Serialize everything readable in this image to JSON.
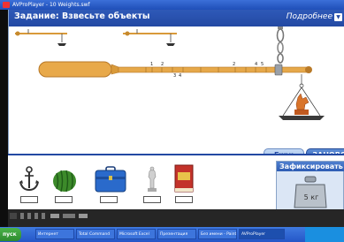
{
  "window": {
    "title": "AVProPlayer - 10 Weights.swf"
  },
  "header": {
    "task_title": "Задание: Взвесьте объекты",
    "more_label": "Подробнее",
    "more_arrow": "▼"
  },
  "scale": {
    "tick_labels": [
      "1",
      "2",
      "3",
      "4",
      "2",
      "4",
      "5"
    ]
  },
  "tabs": {
    "weights": "Гири",
    "reset": "ЗАНОВО"
  },
  "objects": [
    {
      "name": "anchor",
      "label": ""
    },
    {
      "name": "watermelon",
      "label": ""
    },
    {
      "name": "briefcase",
      "label": ""
    },
    {
      "name": "statuette",
      "label": ""
    },
    {
      "name": "book",
      "label": ""
    }
  ],
  "fix_panel": {
    "title": "Зафиксировать",
    "weight_label": "5 кг"
  },
  "taskbar": {
    "start": "пуск",
    "items": [
      "Интернет",
      "Total Command",
      "Microsoft Excel",
      "Презентация",
      "Без имени - Paint",
      "AVProPlayer"
    ]
  },
  "colors": {
    "header": "#2349a3",
    "steelyard": "#e8a94a",
    "accent": "#3f7ae0"
  }
}
